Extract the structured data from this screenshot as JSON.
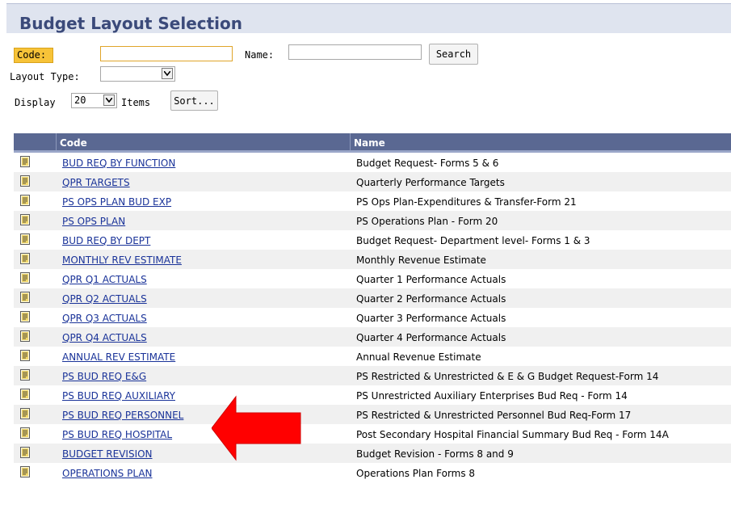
{
  "page": {
    "title": "Budget Layout Selection"
  },
  "search": {
    "code_label": "Code:",
    "code_value": "",
    "name_label": "Name:",
    "name_value": "",
    "search_button": "Search",
    "layout_type_label": "Layout Type:",
    "layout_type_value": "",
    "display_label": "Display",
    "display_value": "20",
    "items_label": "Items",
    "sort_button": "Sort..."
  },
  "table": {
    "columns": [
      "Code",
      "Name"
    ],
    "rows": [
      {
        "code": "BUD REQ BY FUNCTION",
        "name": "Budget Request- Forms 5 & 6"
      },
      {
        "code": "QPR TARGETS",
        "name": "Quarterly Performance Targets"
      },
      {
        "code": "PS OPS PLAN BUD EXP",
        "name": "PS Ops Plan-Expenditures & Transfer-Form 21"
      },
      {
        "code": "PS OPS PLAN",
        "name": "PS Operations Plan - Form 20"
      },
      {
        "code": "BUD REQ BY DEPT",
        "name": "Budget Request- Department level- Forms 1 & 3"
      },
      {
        "code": "MONTHLY REV ESTIMATE",
        "name": "Monthly Revenue Estimate"
      },
      {
        "code": "QPR Q1 ACTUALS",
        "name": "Quarter 1 Performance Actuals"
      },
      {
        "code": "QPR Q2 ACTUALS",
        "name": "Quarter 2 Performance Actuals"
      },
      {
        "code": "QPR Q3 ACTUALS",
        "name": "Quarter 3 Performance Actuals"
      },
      {
        "code": "QPR Q4 ACTUALS",
        "name": "Quarter 4 Performance Actuals"
      },
      {
        "code": "ANNUAL REV ESTIMATE",
        "name": "Annual Revenue Estimate"
      },
      {
        "code": "PS BUD REQ E&G",
        "name": "PS Restricted & Unrestricted & E & G Budget Request-Form 14"
      },
      {
        "code": "PS BUD REQ AUXILIARY",
        "name": "PS Unrestricted Auxiliary Enterprises Bud Req - Form 14"
      },
      {
        "code": "PS BUD REQ PERSONNEL",
        "name": "PS Restricted & Unrestricted Personnel Bud Req-Form 17"
      },
      {
        "code": "PS BUD REQ HOSPITAL",
        "name": "Post Secondary Hospital Financial Summary Bud Req - Form 14A"
      },
      {
        "code": "BUDGET REVISION",
        "name": "Budget Revision - Forms 8 and 9"
      },
      {
        "code": "OPERATIONS PLAN",
        "name": "Operations Plan Forms 8"
      }
    ]
  },
  "colors": {
    "title_bar": "#dfe4ef",
    "title_text": "#3b4a7a",
    "header_bg": "#5a6892",
    "code_label_bg": "#f7c338",
    "link": "#1a3399",
    "annotation_arrow": "#ff0000"
  },
  "icons": {
    "row_icon": "document-icon",
    "annotation": "red-arrow-pointer"
  }
}
